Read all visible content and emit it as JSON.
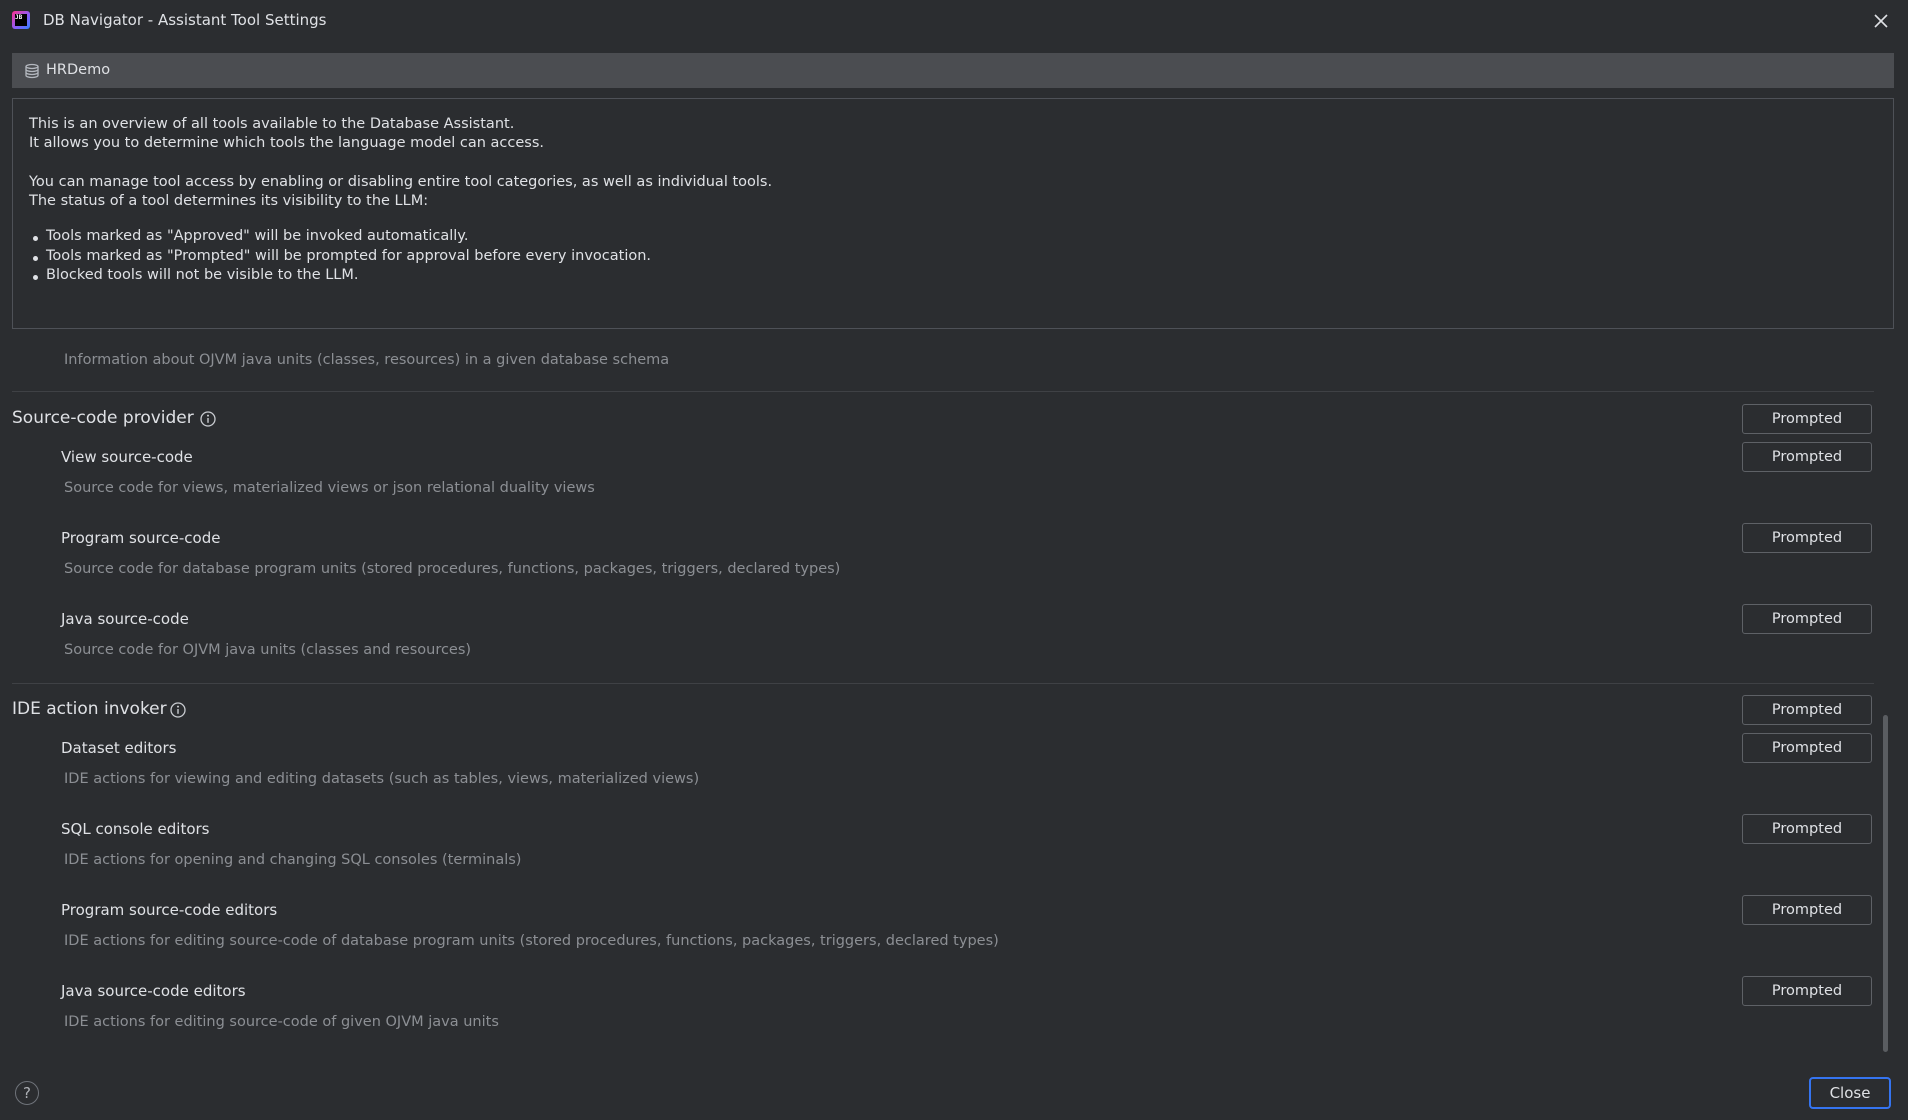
{
  "window": {
    "title": "DB Navigator - Assistant Tool Settings",
    "logo_text": "JB",
    "close_glyph": "close-icon"
  },
  "connection": {
    "name": "HRDemo",
    "icon": "database-icon"
  },
  "info": {
    "line1": "This is an overview of all tools available to the Database Assistant.",
    "line2": "It allows you to determine which tools the language model can access.",
    "line3": "You can manage tool access by enabling or disabling entire tool categories, as well as individual tools.",
    "line4": "The status of a tool determines its visibility to the LLM:",
    "bullets": [
      "Tools marked as \"Approved\" will be invoked automatically.",
      "Tools marked as \"Prompted\" will be prompted for approval before every invocation.",
      "Blocked tools will not be visible to the LLM."
    ]
  },
  "partial_description": "Information about OJVM java units (classes, resources) in a given database schema",
  "categories": [
    {
      "title": "Source-code provider",
      "status": "Prompted",
      "tools": [
        {
          "title": "View source-code",
          "description": "Source code for views, materialized views or json relational duality views",
          "status": "Prompted"
        },
        {
          "title": "Program source-code",
          "description": "Source code for database program units (stored procedures, functions, packages, triggers, declared types)",
          "status": "Prompted"
        },
        {
          "title": "Java source-code",
          "description": "Source code for OJVM java units (classes and resources)",
          "status": "Prompted"
        }
      ]
    },
    {
      "title": "IDE action invoker",
      "status": "Prompted",
      "tools": [
        {
          "title": "Dataset editors",
          "description": "IDE actions for viewing and editing datasets (such as tables, views, materialized views)",
          "status": "Prompted"
        },
        {
          "title": "SQL console editors",
          "description": "IDE actions for opening and changing SQL consoles (terminals)",
          "status": "Prompted"
        },
        {
          "title": "Program source-code editors",
          "description": "IDE actions for editing source-code of database program units (stored procedures, functions, packages, triggers, declared types)",
          "status": "Prompted"
        },
        {
          "title": "Java source-code editors",
          "description": "IDE actions for editing source-code of given OJVM java units",
          "status": "Prompted"
        }
      ]
    }
  ],
  "footer": {
    "help_label": "?",
    "close_label": "Close"
  }
}
